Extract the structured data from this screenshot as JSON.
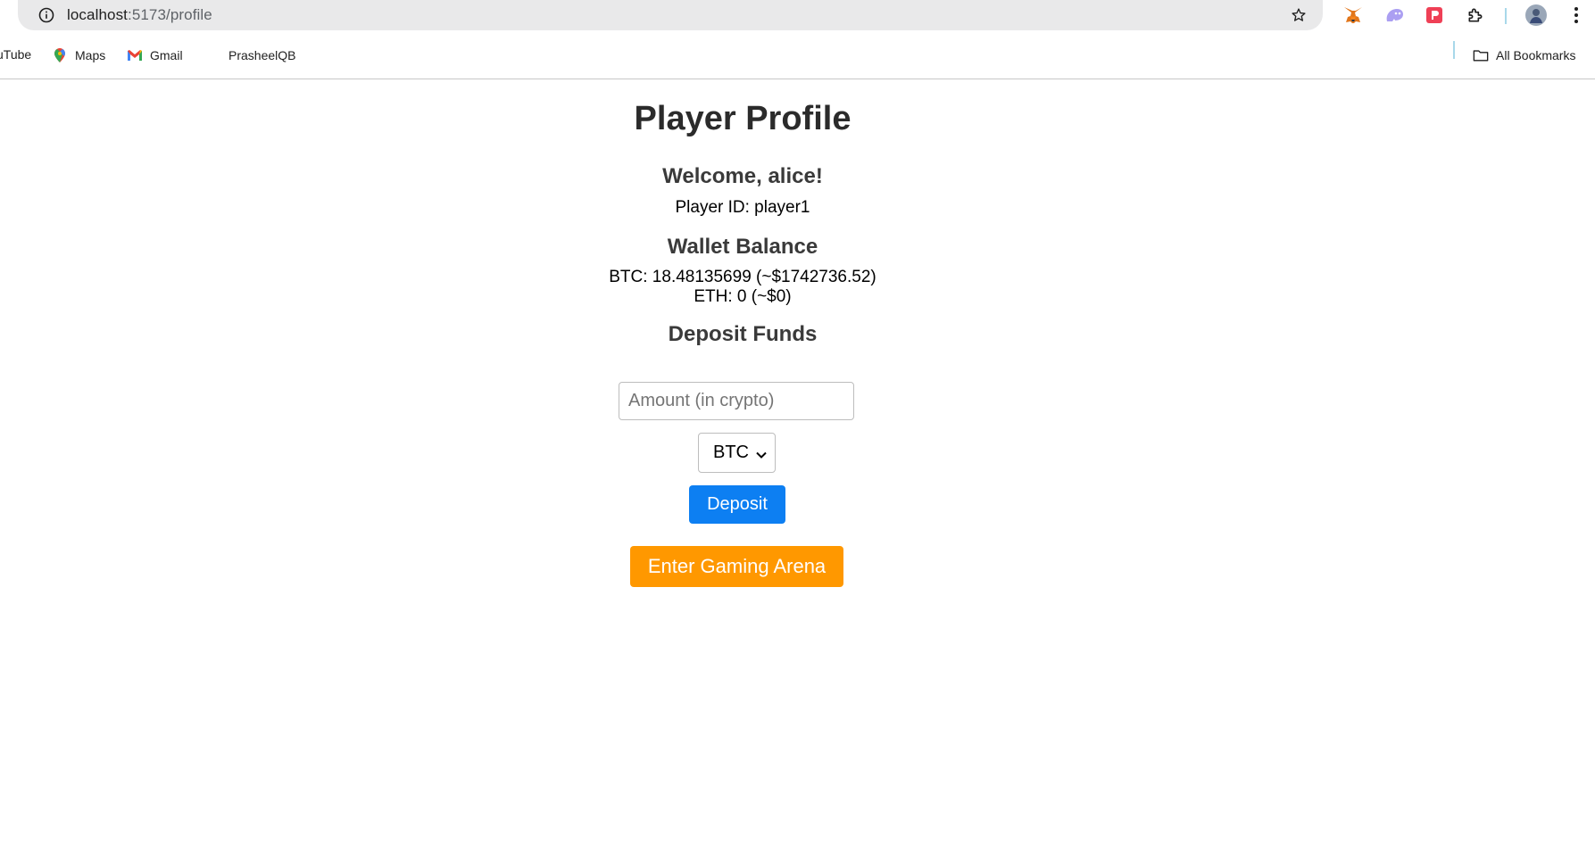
{
  "browser": {
    "url_host": "localhost",
    "url_path": ":5173/profile",
    "bookmarks": [
      {
        "label": "uTube",
        "icon": "youtube-icon"
      },
      {
        "label": "Maps",
        "icon": "google-maps-icon"
      },
      {
        "label": "Gmail",
        "icon": "gmail-icon"
      },
      {
        "label": "PrasheelQB",
        "icon": "blank-page-icon"
      }
    ],
    "all_bookmarks_label": "All Bookmarks",
    "extensions": [
      "metamask-icon",
      "phantom-icon",
      "pocket-icon",
      "puzzle-extensions-icon"
    ],
    "colors": {
      "omnibox": "#e9e9ea"
    }
  },
  "profile": {
    "title": "Player Profile",
    "welcome": "Welcome, alice!",
    "player_id": "Player ID: player1",
    "wallet_heading": "Wallet Balance",
    "btc_line": "BTC: 18.48135699 (~$1742736.52)",
    "eth_line": "ETH: 0 (~$0)",
    "deposit_heading": "Deposit Funds",
    "amount_placeholder": "Amount (in crypto)",
    "amount_value": "",
    "currency_selected": "BTC",
    "deposit_button": "Deposit",
    "arena_button": "Enter Gaming Arena",
    "colors": {
      "deposit": "#0d7ff2",
      "arena": "#ff9800"
    }
  }
}
